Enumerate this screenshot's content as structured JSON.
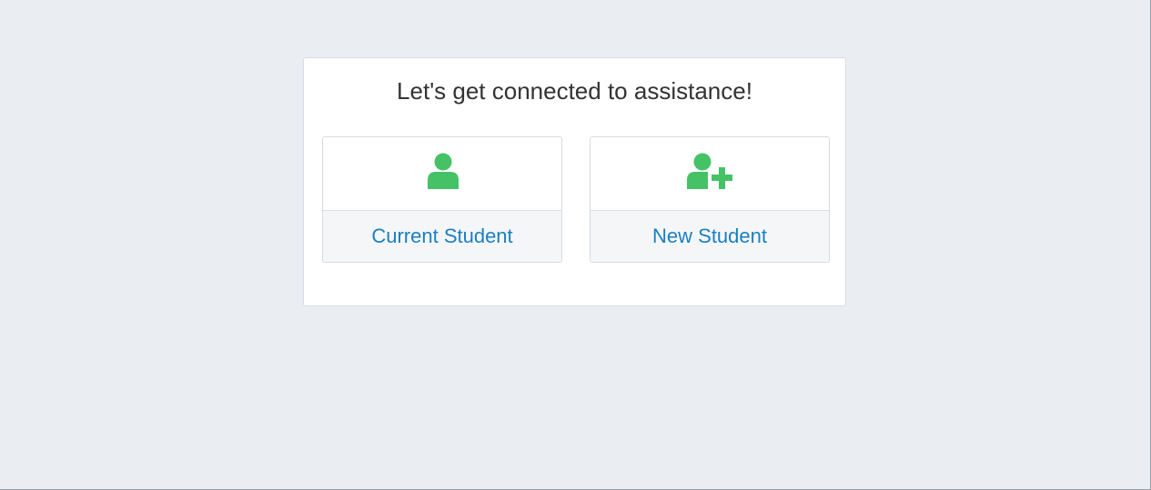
{
  "heading": "Let's get connected to assistance!",
  "options": [
    {
      "label": "Current Student",
      "icon": "user-icon"
    },
    {
      "label": "New Student",
      "icon": "user-plus-icon"
    }
  ],
  "colors": {
    "page_background": "#eaedf2",
    "card_background": "#ffffff",
    "icon_green": "#45c266",
    "link_blue": "#1a7fc1",
    "heading_text": "#333333"
  }
}
